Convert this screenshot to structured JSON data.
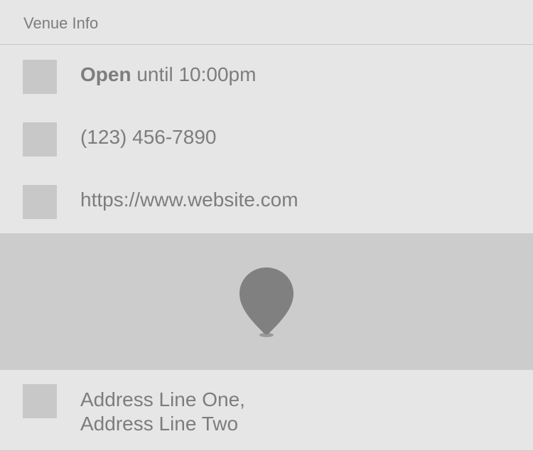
{
  "header": {
    "title": "Venue Info"
  },
  "hours": {
    "icon": "clock-icon",
    "status": "Open",
    "detail": " until 10:00pm"
  },
  "phone": {
    "icon": "phone-icon",
    "number": "(123) 456-7890"
  },
  "website": {
    "icon": "globe-icon",
    "url": "https://www.website.com"
  },
  "map": {
    "icon": "map-pin-icon"
  },
  "address": {
    "icon": "location-icon",
    "line1": "Address Line One,",
    "line2": "Address Line Two"
  },
  "colors": {
    "background": "#e6e6e6",
    "placeholder": "#c8c8c8",
    "map": "#cccccc",
    "pin": "#808080",
    "text": "#7d7d7d"
  }
}
